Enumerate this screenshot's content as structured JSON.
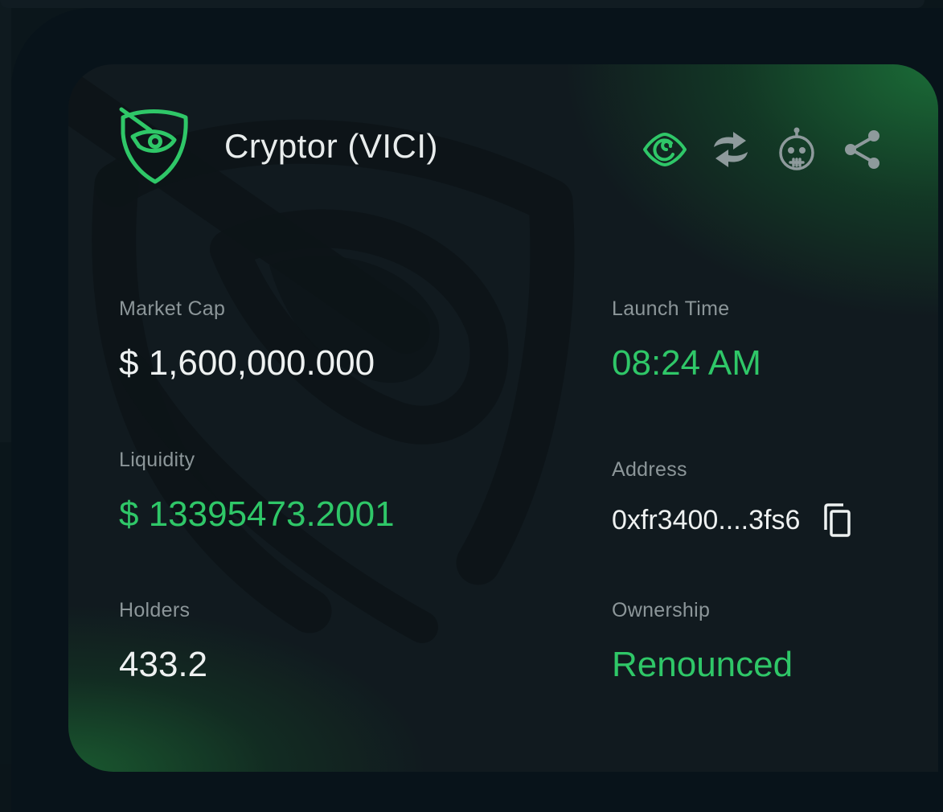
{
  "token": {
    "name": "Cryptor (VICI)"
  },
  "actions": [
    {
      "icon": "eye-icon",
      "label": "Watch",
      "color": "#2fc768"
    },
    {
      "icon": "swap-icon",
      "label": "Swap",
      "color": "#8e9a9c"
    },
    {
      "icon": "robot-icon",
      "label": "Bot",
      "color": "#8e9a9c"
    },
    {
      "icon": "share-icon",
      "label": "Share",
      "color": "#8e9a9c"
    }
  ],
  "stats": {
    "market_cap": {
      "label": "Market Cap",
      "value": "$ 1,600,000.000"
    },
    "launch_time": {
      "label": "Launch Time",
      "value": "08:24 AM"
    },
    "liquidity": {
      "label": "Liquidity",
      "value": "$ 13395473.2001"
    },
    "address": {
      "label": "Address",
      "value": "0xfr3400....3fs6"
    },
    "holders": {
      "label": "Holders",
      "value": "433.2"
    },
    "ownership": {
      "label": "Ownership",
      "value": "Renounced"
    }
  },
  "colors": {
    "accent_green": "#2fc768",
    "card_bg": "#111a1f",
    "label_gray": "#8c9699",
    "value_white": "#eef1f1"
  }
}
